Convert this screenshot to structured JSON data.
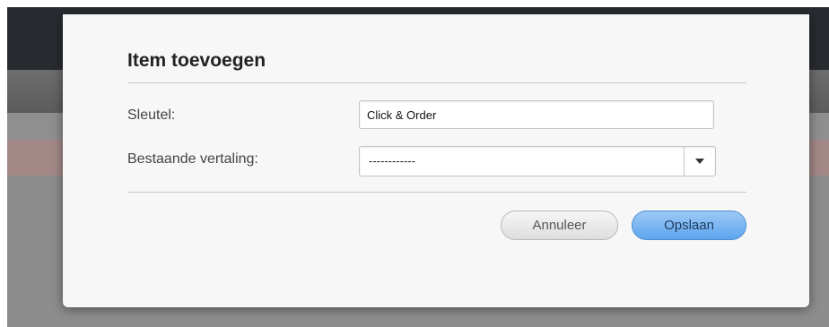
{
  "dialog": {
    "title": "Item toevoegen",
    "key_label": "Sleutel:",
    "key_value": "Click & Order",
    "translation_label": "Bestaande vertaling:",
    "translation_selected": "------------",
    "cancel_label": "Annuleer",
    "save_label": "Opslaan"
  },
  "icons": {
    "dropdown": "chevron-down-icon"
  },
  "colors": {
    "save_button": "#5ea5ee",
    "cancel_button": "#e6e6e6",
    "top_bar": "#282b30"
  }
}
